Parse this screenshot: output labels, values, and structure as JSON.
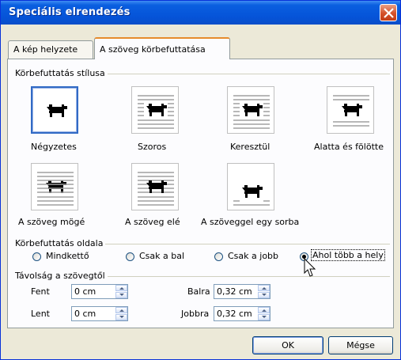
{
  "window": {
    "title": "Speciális elrendezés"
  },
  "tabs": [
    {
      "label": "A kép helyzete",
      "active": false
    },
    {
      "label": "A szöveg körbefuttatása",
      "active": true
    }
  ],
  "wrap_style": {
    "group_label": "Körbefuttatás stílusa",
    "options": [
      {
        "label": "Négyzetes",
        "selected": true,
        "icon": "square-wrap-icon"
      },
      {
        "label": "Szoros",
        "selected": false,
        "icon": "tight-wrap-icon"
      },
      {
        "label": "Keresztül",
        "selected": false,
        "icon": "through-wrap-icon"
      },
      {
        "label": "Alatta és fölötte",
        "selected": false,
        "icon": "top-bottom-wrap-icon"
      },
      {
        "label": "A szöveg mögé",
        "selected": false,
        "icon": "behind-text-icon"
      },
      {
        "label": "A szöveg elé",
        "selected": false,
        "icon": "in-front-text-icon"
      },
      {
        "label": "A szöveggel egy sorba",
        "selected": false,
        "icon": "inline-text-icon"
      }
    ]
  },
  "wrap_side": {
    "group_label": "Körbefuttatás oldala",
    "options": [
      {
        "label": "Mindkettő",
        "selected": false
      },
      {
        "label": "Csak a bal",
        "selected": false
      },
      {
        "label": "Csak a jobb",
        "selected": false
      },
      {
        "label": "Ahol több a hely",
        "selected": true
      }
    ]
  },
  "distance": {
    "group_label": "Távolság a szövegtől",
    "top": {
      "label": "Fent",
      "value": "0 cm"
    },
    "bottom": {
      "label": "Lent",
      "value": "0 cm"
    },
    "left": {
      "label": "Balra",
      "value": "0,32 cm"
    },
    "right": {
      "label": "Jobbra",
      "value": "0,32 cm"
    }
  },
  "buttons": {
    "ok": "OK",
    "cancel": "Mégse"
  },
  "colors": {
    "title_bar": "#0553d8",
    "selection": "#316ac5",
    "close": "#d4502a"
  }
}
